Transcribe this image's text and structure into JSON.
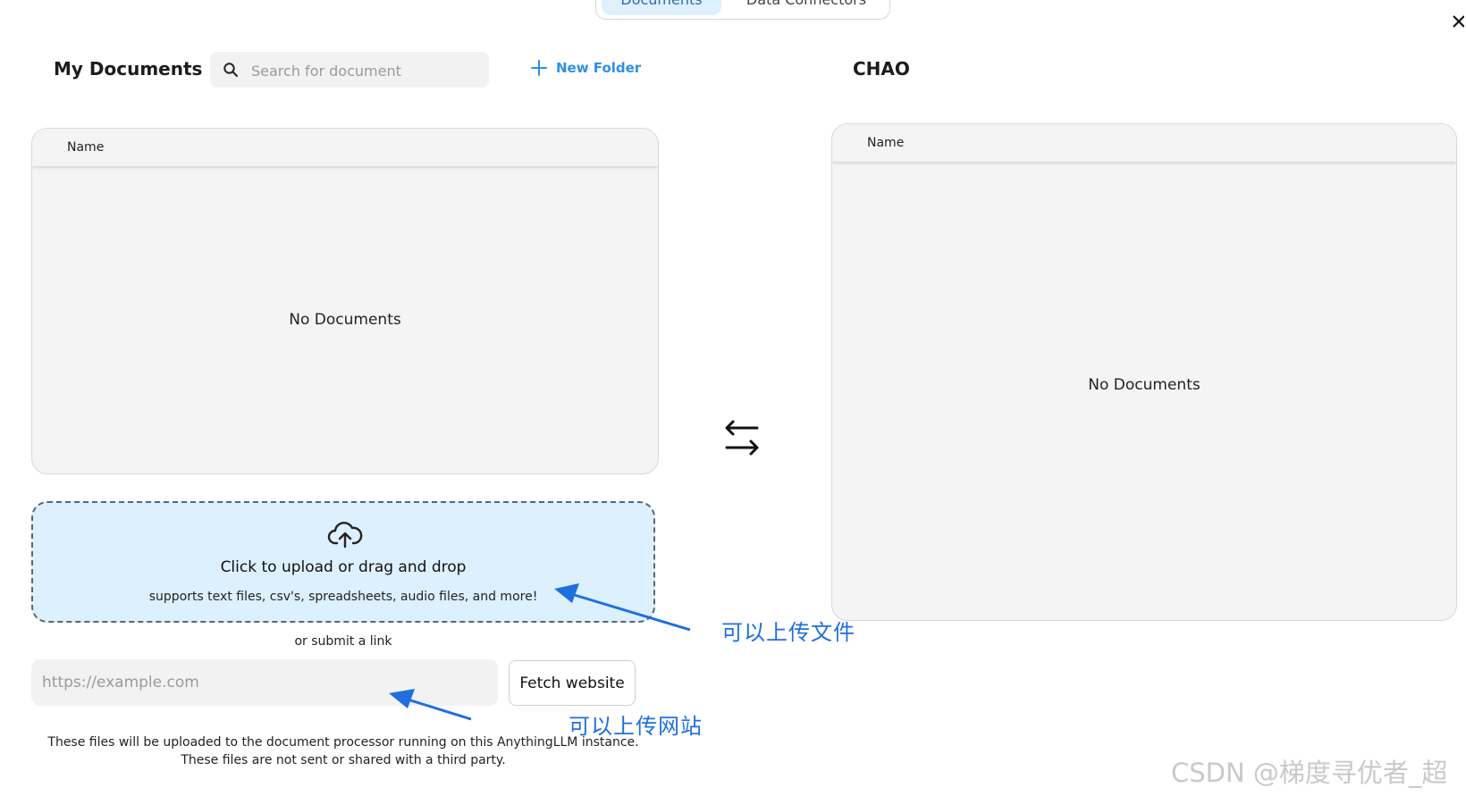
{
  "top_tabs": [
    {
      "label": "Documents",
      "active": true
    },
    {
      "label": "Data Connectors",
      "active": false
    }
  ],
  "left": {
    "title": "My Documents",
    "search": {
      "placeholder": "Search for document",
      "value": ""
    },
    "new_folder_label": "New Folder",
    "table_header": "Name",
    "empty_text": "No Documents"
  },
  "right": {
    "title": "CHAO",
    "table_header": "Name",
    "empty_text": "No Documents"
  },
  "upload": {
    "title": "Click to upload or drag and drop",
    "subtitle": "supports text files, csv's, spreadsheets, audio files, and more!",
    "or_link": "or submit a link",
    "url_placeholder": "https://example.com",
    "fetch_label": "Fetch website",
    "note_line1": "These files will be uploaded to the document processor running on this AnythingLLM instance.",
    "note_line2": "These files are not sent or shared with a third party."
  },
  "annotations": {
    "upload_files": "可以上传文件",
    "upload_website": "可以上传网站",
    "color": "#1f6fe0"
  },
  "watermark": "CSDN @梯度寻优者_超",
  "colors": {
    "accent": "#2f8fe8",
    "upload_bg": "#ddf0fd",
    "panel_bg": "#f4f4f4"
  }
}
